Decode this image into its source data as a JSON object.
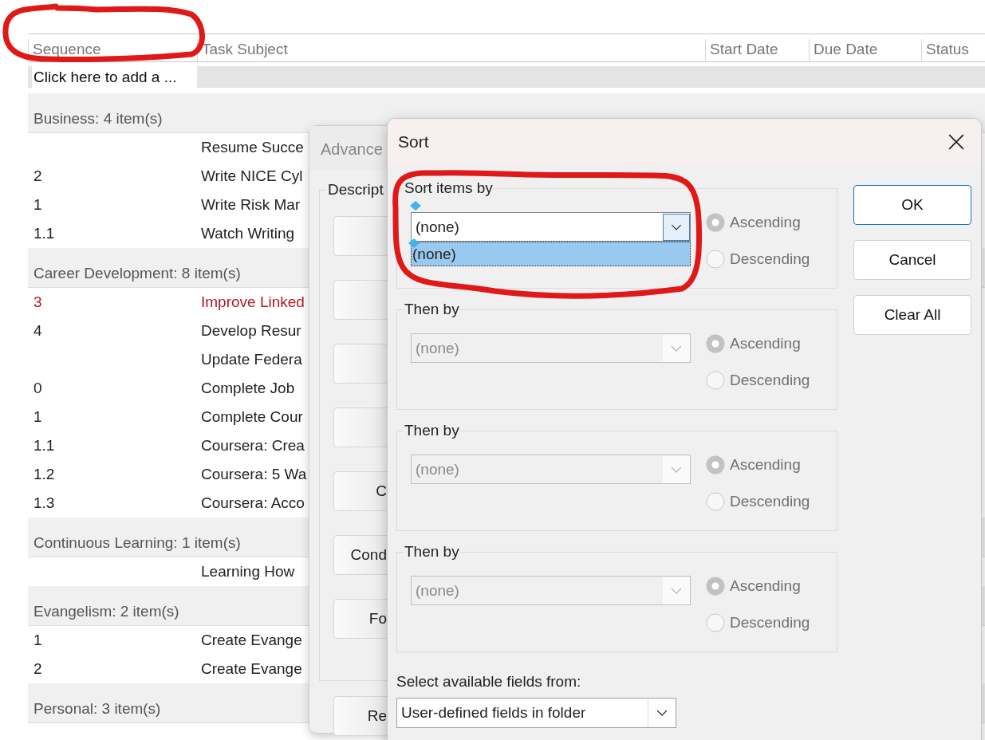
{
  "task_list": {
    "columns": [
      {
        "label": "Sequence"
      },
      {
        "label": "Task Subject"
      },
      {
        "label": "Start Date"
      },
      {
        "label": "Due Date"
      },
      {
        "label": "Status"
      }
    ],
    "new_item_row": {
      "placeholder": "Click here to add a ..."
    },
    "groups": [
      {
        "label": "Business: 4 item(s)",
        "tasks": [
          {
            "subject": "Resume Succe",
            "overdue": false
          },
          {
            "sequence": "2",
            "subject": "Write NICE Cyl",
            "overdue": false
          },
          {
            "sequence": "1",
            "subject": "Write Risk Mar",
            "overdue": false
          },
          {
            "sequence": "1.1",
            "subject": "Watch Writing",
            "overdue": false
          }
        ]
      },
      {
        "label": "Career Development: 8 item(s)",
        "tasks": [
          {
            "sequence": "3",
            "subject": "Improve Linked",
            "overdue": true
          },
          {
            "sequence": "4",
            "subject": "Develop Resur",
            "overdue": false
          },
          {
            "subject": "Update Federa",
            "overdue": false
          },
          {
            "sequence": "0",
            "subject": "Complete Job",
            "overdue": false
          },
          {
            "sequence": "1",
            "subject": "Complete Cour",
            "overdue": false
          },
          {
            "sequence": "1.1",
            "subject": "Coursera: Crea",
            "overdue": false
          },
          {
            "sequence": "1.2",
            "subject": "Coursera: 5 Wa",
            "overdue": false
          },
          {
            "sequence": "1.3",
            "subject": "Coursera: Acco",
            "overdue": false
          }
        ]
      },
      {
        "label": "Continuous Learning: 1 item(s)",
        "tasks": [
          {
            "subject": "Learning How",
            "overdue": false
          }
        ]
      },
      {
        "label": "Evangelism: 2 item(s)",
        "tasks": [
          {
            "sequence": "1",
            "subject": "Create Evange",
            "overdue": false
          },
          {
            "sequence": "2",
            "subject": "Create Evange",
            "overdue": false
          }
        ]
      },
      {
        "label": "Personal: 3 item(s)"
      }
    ]
  },
  "advanced_dialog": {
    "title": "Advance",
    "group_label": "Descript",
    "buttons": [
      {
        "kind": "blank"
      },
      {
        "kind": "blank"
      },
      {
        "kind": "blank"
      },
      {
        "kind": "blank"
      },
      {
        "kind": "labelled",
        "label": "C"
      },
      {
        "kind": "labelled",
        "label": "Cond"
      },
      {
        "kind": "labelled",
        "label": "Fo"
      },
      {
        "kind": "labelled",
        "label": "Re"
      }
    ]
  },
  "sort_dialog": {
    "title": "Sort",
    "levels": [
      {
        "label": "Sort items by",
        "value": "(none)",
        "disabled": false,
        "expanded": true,
        "options": [
          {
            "label": "(none)",
            "selected": true
          }
        ],
        "radios": [
          {
            "label": "Ascending",
            "selected": true,
            "disabled": true
          },
          {
            "label": "Descending",
            "selected": false,
            "disabled": true
          }
        ]
      },
      {
        "label": "Then by",
        "value": "(none)",
        "disabled": true,
        "expanded": false,
        "radios": [
          {
            "label": "Ascending",
            "selected": true,
            "disabled": true
          },
          {
            "label": "Descending",
            "selected": false,
            "disabled": true
          }
        ]
      },
      {
        "label": "Then by",
        "value": "(none)",
        "disabled": true,
        "expanded": false,
        "radios": [
          {
            "label": "Ascending",
            "selected": true,
            "disabled": true
          },
          {
            "label": "Descending",
            "selected": false,
            "disabled": true
          }
        ]
      },
      {
        "label": "Then by",
        "value": "(none)",
        "disabled": true,
        "expanded": false,
        "radios": [
          {
            "label": "Ascending",
            "selected": true,
            "disabled": true
          },
          {
            "label": "Descending",
            "selected": false,
            "disabled": true
          }
        ]
      }
    ],
    "fields_from": {
      "label": "Select available fields from:",
      "value": "User-defined fields in folder"
    },
    "buttons": [
      {
        "label": "OK",
        "default": true
      },
      {
        "label": "Cancel",
        "default": false
      },
      {
        "label": "Clear All",
        "default": false
      }
    ]
  }
}
